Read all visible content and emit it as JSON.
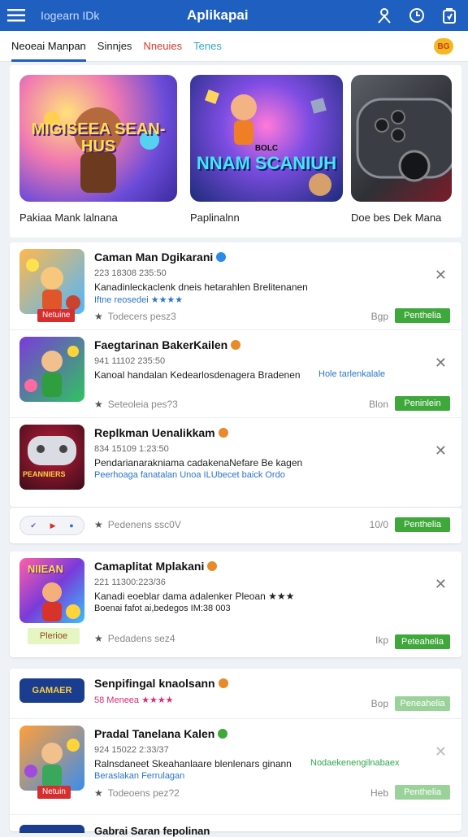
{
  "header": {
    "search_hint": "Iogearn IDk",
    "title": "Aplikapai",
    "icons": [
      "menu-icon",
      "user-icon",
      "clock-icon",
      "bag-icon"
    ]
  },
  "tabs": [
    {
      "label": "Neoeai Manpan",
      "active": true
    },
    {
      "label": "Sinnjes",
      "active": false
    },
    {
      "label": "Nneuies",
      "active": false
    },
    {
      "label": "Tenes",
      "active": false
    }
  ],
  "coin_label": "BG",
  "featured": [
    {
      "art_title": "MIGISEEA SEAN-HUS",
      "label": "Pakiaa Mank lalnana"
    },
    {
      "art_title": "NNAM SCANIUH",
      "art_sub": "BOLC",
      "label": "Paplinalnn"
    },
    {
      "art_title": "",
      "label": "Doe bes Dek Mana"
    }
  ],
  "apps_group1": [
    {
      "name": "Caman Man Dgikarani",
      "meta": "223 18308 235:50",
      "desc": "Kanadinleckaclenk dneis hetarahlen Brelitenanen",
      "desc2": "Iftne reosedei ★★★★",
      "rating": "Todecers pesz3",
      "size": "Bgp",
      "install": "Penthelia",
      "badge": "Netuine"
    },
    {
      "name": "Faegtarinan BakerKailen",
      "meta": "941 11102 235:50",
      "desc": "Kanoal handalan Kedearlosdenagera Bradenen",
      "desc2": "Hole tarlenkalale",
      "rating": "Seteoleia pes?3",
      "size": "Blon",
      "install": "Peninlein"
    },
    {
      "name": "Replkman Uenalikkam",
      "meta": "834 15109 1:23:50",
      "desc": "Pendarianarakniama cadakenaNefare Be kagen",
      "desc2": "Peerhoaga fanatalan Unoa ILUbecet baick Ordo",
      "rating": "Pedenens ssc0V",
      "size": "10/0",
      "install": "Penthelia",
      "art_title": "PEANNIERS"
    }
  ],
  "apps_group2": [
    {
      "name": "Camaplitat Mplakani",
      "meta": "221 11300:223/36",
      "desc": "Kanadi eoeblar dama adalenker Pleoan ★★★",
      "desc2": "Boenai fafot ai,bedegos IM:38 003",
      "rating": "Pedadens sez4",
      "size": "Ikp",
      "install": "Peteahelia",
      "promo": "Plerioe",
      "art_title": "NIIEAN"
    }
  ],
  "apps_group3": [
    {
      "name": "Senpifingal knaolsann",
      "meta": "58 Meneea ★★★★",
      "size": "Bop",
      "install": "Peneahelia",
      "art_title": "GAMAER"
    },
    {
      "name": "Pradal Tanelana Kalen",
      "meta": "924 15022 2:33/37",
      "desc": "Ralnsdaneet Skeahanlaare blenlenars ginann",
      "desc2": "Beraslakan Ferrulagan",
      "extra": "Nodaekenengilnabaex",
      "rating": "Todeoens pez?2",
      "size": "Heb",
      "install": "Penthelia",
      "badge": "Netuin"
    }
  ],
  "partial": {
    "name": "Gabrai Saran fepolinan"
  },
  "colors": {
    "header": "#1f5fbf",
    "install": "#3fa83b",
    "badge": "#d62d2d"
  }
}
